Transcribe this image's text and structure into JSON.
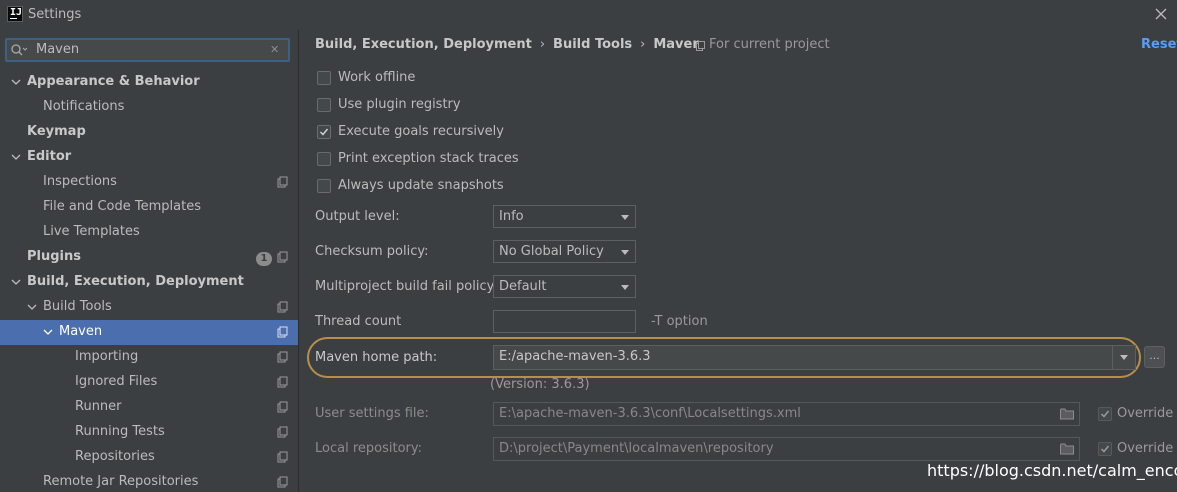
{
  "window": {
    "title": "Settings"
  },
  "search": {
    "value": "Maven"
  },
  "sidebar": {
    "items": [
      {
        "label": "Appearance & Behavior"
      },
      {
        "label": "Notifications"
      },
      {
        "label": "Keymap"
      },
      {
        "label": "Editor"
      },
      {
        "label": "Inspections"
      },
      {
        "label": "File and Code Templates"
      },
      {
        "label": "Live Templates"
      },
      {
        "label": "Plugins",
        "badge": "1"
      },
      {
        "label": "Build, Execution, Deployment"
      },
      {
        "label": "Build Tools"
      },
      {
        "label": "Maven"
      },
      {
        "label": "Importing"
      },
      {
        "label": "Ignored Files"
      },
      {
        "label": "Runner"
      },
      {
        "label": "Running Tests"
      },
      {
        "label": "Repositories"
      },
      {
        "label": "Remote Jar Repositories"
      }
    ]
  },
  "header": {
    "breadcrumb": [
      "Build, Execution, Deployment",
      "Build Tools",
      "Maven"
    ],
    "separator": "›",
    "scope": "For current project",
    "reset": "Reset"
  },
  "options": [
    {
      "label": "Work offline",
      "checked": false
    },
    {
      "label": "Use plugin registry",
      "checked": false
    },
    {
      "label": "Execute goals recursively",
      "checked": true
    },
    {
      "label": "Print exception stack traces",
      "checked": false
    },
    {
      "label": "Always update snapshots",
      "checked": false
    }
  ],
  "form": {
    "output_level": {
      "label": "Output level:",
      "value": "Info"
    },
    "checksum_policy": {
      "label": "Checksum policy:",
      "value": "No Global Policy"
    },
    "multiproject_policy": {
      "label": "Multiproject build fail policy:",
      "value": "Default"
    },
    "thread_count": {
      "label": "Thread count",
      "value": "",
      "hint": "-T option"
    },
    "maven_home": {
      "label": "Maven home path:",
      "value": "E:/apache-maven-3.6.3",
      "version": "(Version: 3.6.3)",
      "browse": "..."
    },
    "user_settings": {
      "label": "User settings file:",
      "value": "E:\\apache-maven-3.6.3\\conf\\Localsettings.xml",
      "override_label": "Override",
      "override": true
    },
    "local_repo": {
      "label": "Local repository:",
      "value": "D:\\project\\Payment\\localmaven\\repository",
      "override_label": "Override",
      "override": true
    }
  },
  "watermark": "https://blog.csdn.net/calm_encode",
  "colors": {
    "background": "#3c3f41",
    "selection": "#4b6eaf",
    "link": "#589df6",
    "highlight": "#b78f4a"
  }
}
